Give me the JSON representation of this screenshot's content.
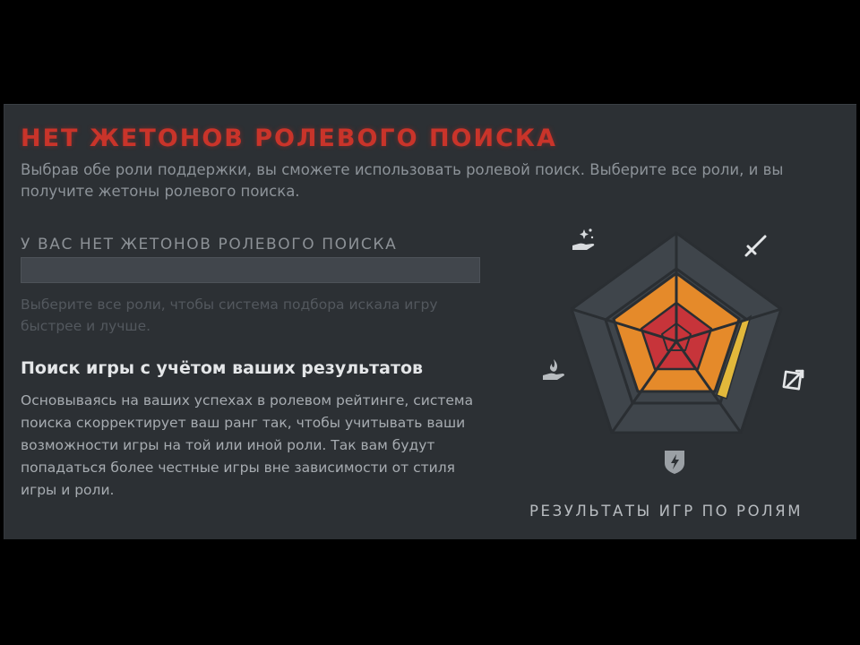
{
  "panel": {
    "title": "НЕТ ЖЕТОНОВ РОЛЕВОГО ПОИСКА",
    "subtitle": "Выбрав обе роли поддержки, вы сможете использовать ролевой поиск. Выберите все роли, и вы получите жетоны ролевого поиска.",
    "tokens_heading": "У ВАС НЕТ ЖЕТОНОВ РОЛЕВОГО ПОИСКА",
    "token_progress": 0,
    "hint": "Выберите все роли, чтобы система подбора искала игру быстрее и лучше.",
    "section_heading": "Поиск игры с учётом ваших результатов",
    "section_body": "Основываясь на ваших успехах в ролевом рейтинге, система поиска скорректирует ваш ранг так, чтобы учитывать ваши возможности игры на той или иной роли. Так вам будут попадаться более честные игры вне зависимости от стиля игры и роли.",
    "results_label": "РЕЗУЛЬТАТЫ ИГР ПО РОЛЯМ"
  },
  "role_chart": {
    "roles": [
      {
        "name": "carry",
        "icon": "sword-icon"
      },
      {
        "name": "offlane",
        "icon": "shield-arrow-icon"
      },
      {
        "name": "mid",
        "icon": "lightning-shield-icon"
      },
      {
        "name": "hard-support",
        "icon": "hand-flame-icon"
      },
      {
        "name": "soft-support",
        "icon": "hand-sparkle-icon"
      }
    ],
    "colors": {
      "background": "#2c3034",
      "outer_ring": "#3f454b",
      "ring_outline": "#2a2e32",
      "orange": "#e58a2a",
      "red": "#c7343a",
      "yellow": "#e2b83b",
      "icon": "#d8dbde"
    }
  }
}
